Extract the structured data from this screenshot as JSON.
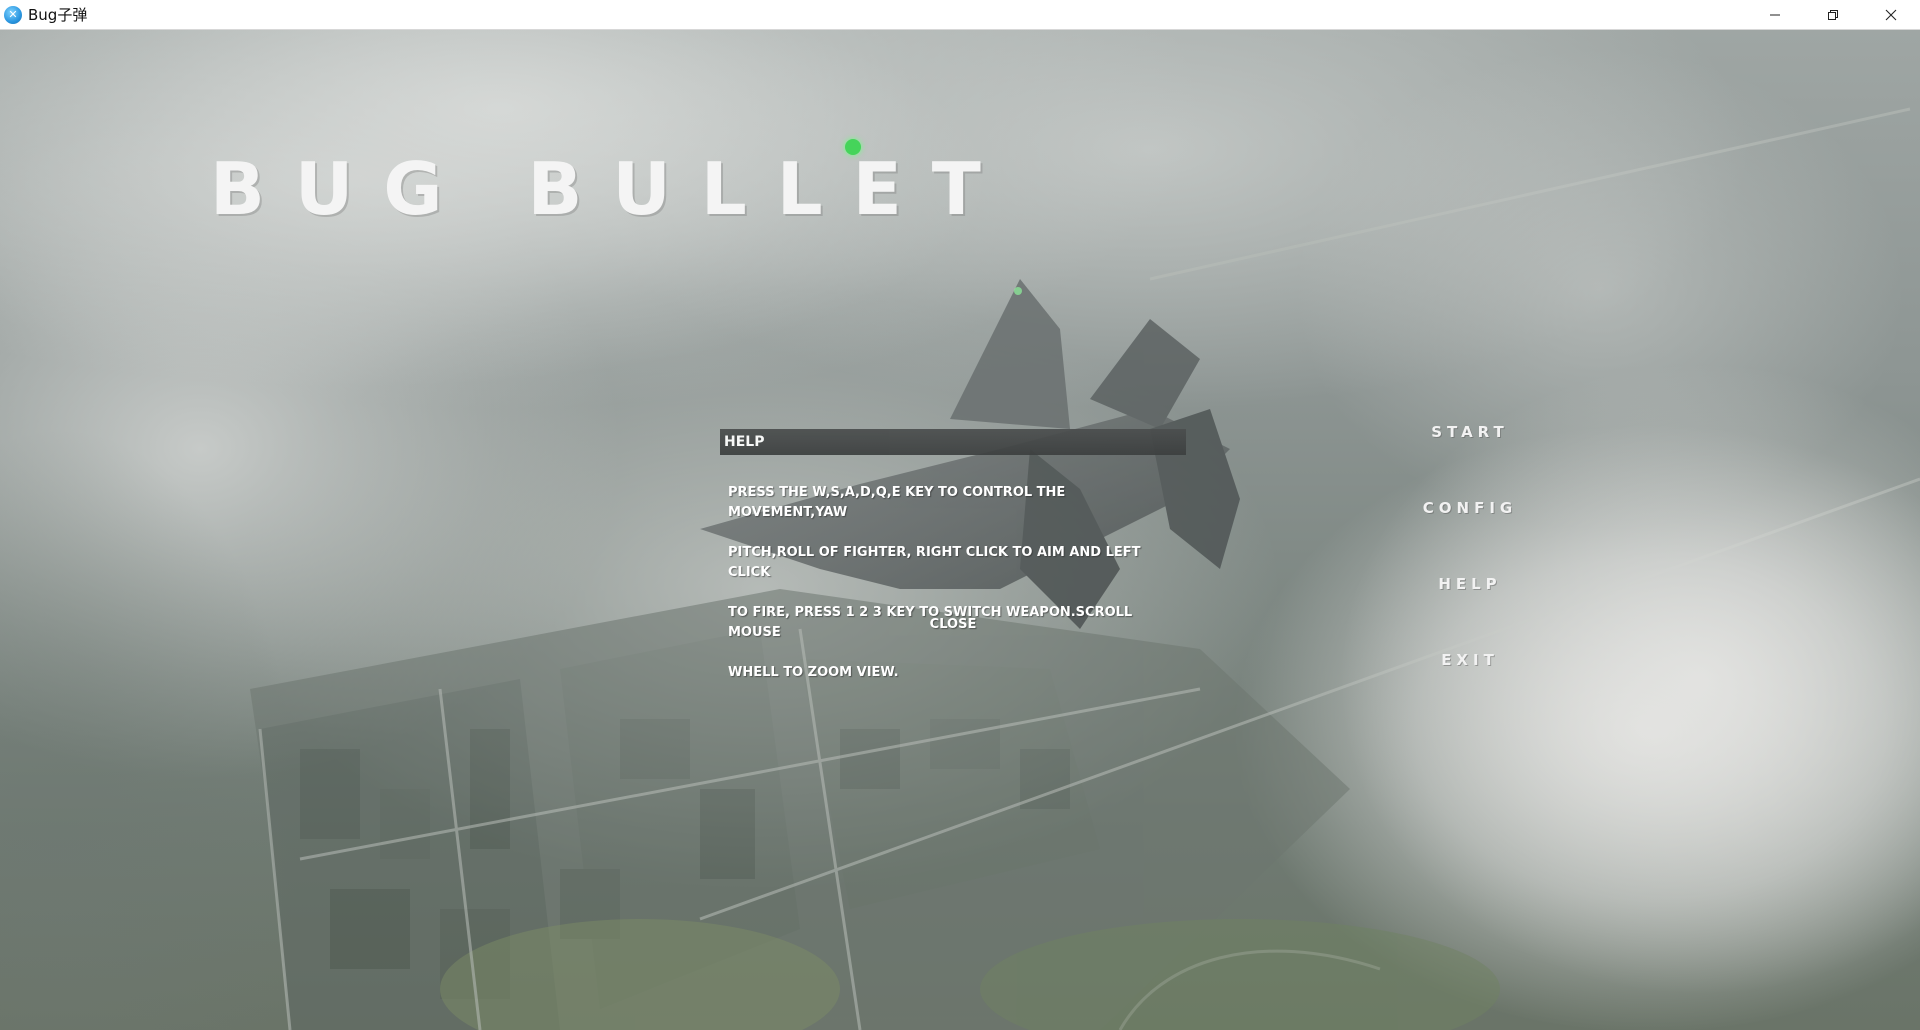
{
  "window": {
    "title": "Bug子弹",
    "icon_name": "app-icon",
    "controls": [
      "minimize-icon",
      "restore-icon",
      "close-icon"
    ]
  },
  "game": {
    "logo_text": "BUG BULLET"
  },
  "menu": {
    "items": [
      {
        "label": "START"
      },
      {
        "label": "CONFIG"
      },
      {
        "label": "HELP"
      },
      {
        "label": "EXIT"
      }
    ]
  },
  "help_dialog": {
    "title": "HELP",
    "body_lines": [
      "PRESS THE W,S,A,D,Q,E KEY TO CONTROL THE MOVEMENT,YAW",
      "PITCH,ROLL OF FIGHTER, RIGHT CLICK TO AIM AND LEFT CLICK",
      " TO FIRE, PRESS 1 2 3 KEY TO SWITCH WEAPON.SCROLL MOUSE",
      "WHELL TO ZOOM VIEW."
    ],
    "close_label": "CLOSE"
  },
  "colors": {
    "dialog_header": "#3f4242",
    "menu_text": "#f2f2f2",
    "status_dot": "#45d45a"
  }
}
